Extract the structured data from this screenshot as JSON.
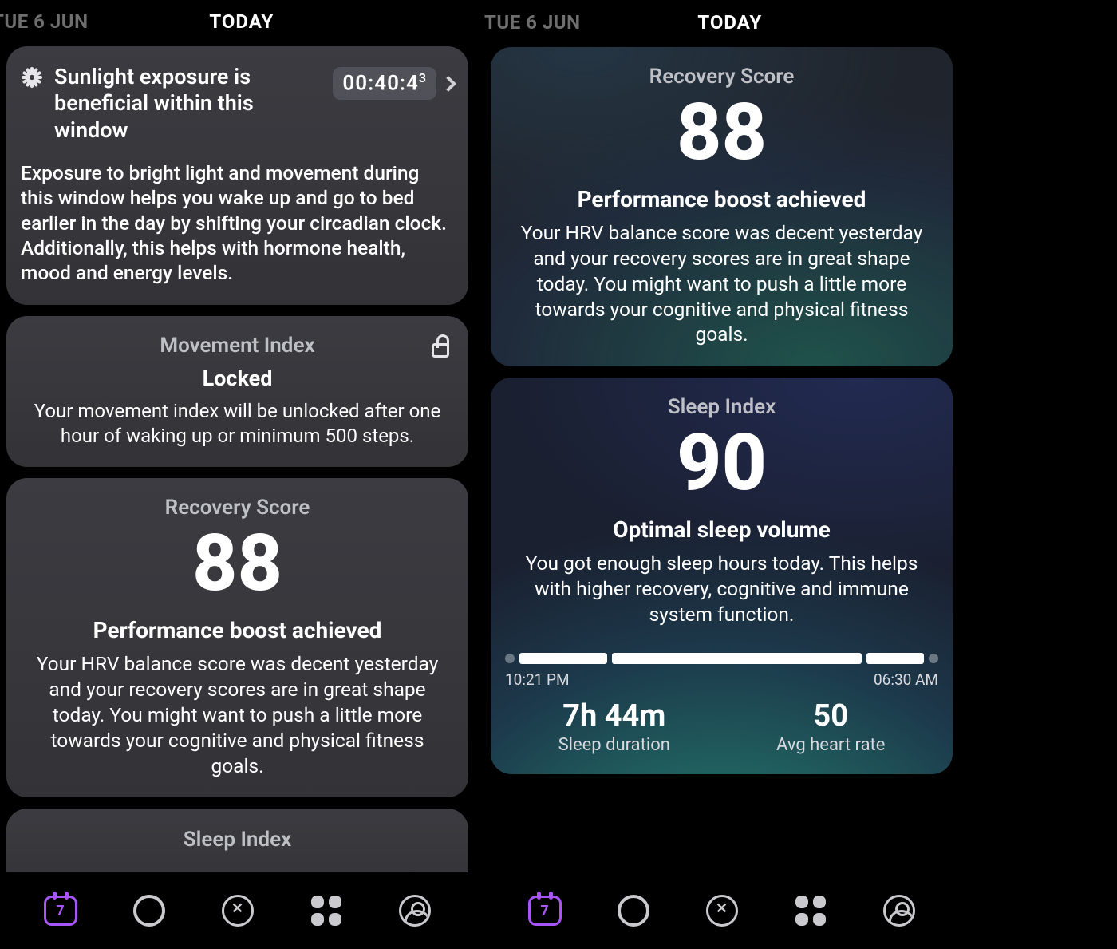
{
  "status": {
    "date": "TUE 6 JUN",
    "today": "TODAY"
  },
  "sunlight": {
    "title": "Sunlight exposure is beneficial within this window",
    "timer": "00:40:4",
    "timerSup": "3",
    "body": "Exposure to bright light and movement during this window helps you wake up and go to bed earlier in the day by shifting your circadian clock. Additionally, this helps with hormone health, mood and energy levels."
  },
  "movement": {
    "title": "Movement Index",
    "locked": "Locked",
    "desc": "Your movement index will be unlocked after one hour of waking up or minimum 500 steps."
  },
  "recovery": {
    "title": "Recovery Score",
    "score": "88",
    "headline": "Performance boost achieved",
    "body": "Your HRV balance score was decent yesterday and your recovery scores are in great shape today. You might want to push a little more towards your cognitive and physical fitness goals."
  },
  "sleepStubTitle": "Sleep Index",
  "sleep": {
    "title": "Sleep Index",
    "score": "90",
    "headline": "Optimal sleep volume",
    "body": "You got enough sleep hours today. This helps with higher recovery, cognitive and immune system function.",
    "start": "10:21 PM",
    "end": "06:30 AM",
    "durationVal": "7h 44m",
    "durationLbl": "Sleep duration",
    "hrVal": "50",
    "hrLbl": "Avg heart rate"
  },
  "nav": {
    "calDay": "7"
  }
}
